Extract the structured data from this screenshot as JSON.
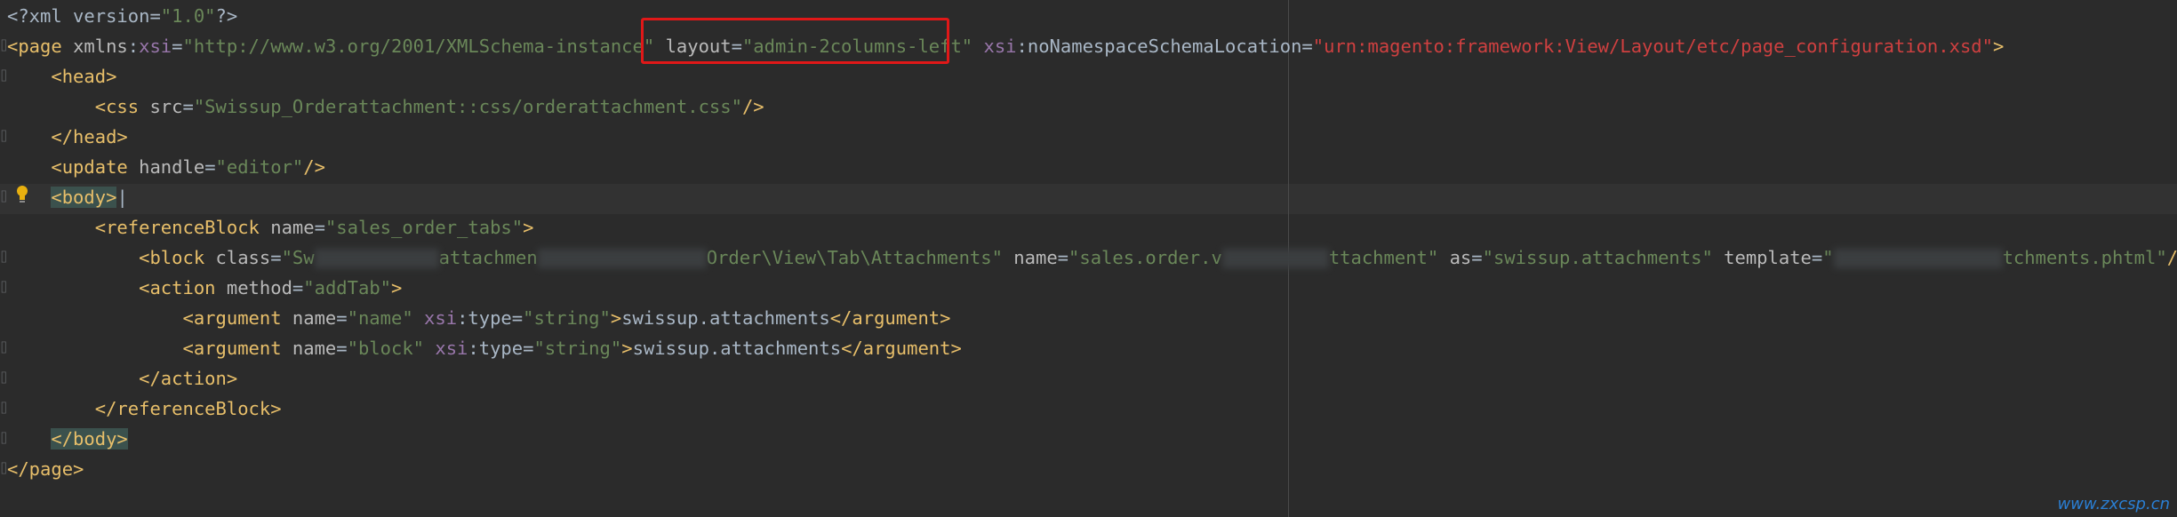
{
  "lines": [
    {
      "parts": [
        [
          "t-txt",
          "<?xml version="
        ],
        [
          "t-str",
          "\"1.0\""
        ],
        [
          "t-txt",
          "?>"
        ]
      ]
    },
    {
      "parts": [
        [
          "t-tag",
          "<page "
        ],
        [
          "t-attr",
          "xmlns"
        ],
        [
          "t-txt",
          ":"
        ],
        [
          "t-ns",
          "xsi"
        ],
        [
          "t-txt",
          "="
        ],
        [
          "t-str",
          "\"http://www.w3.org/2001/XMLSchema-instance\""
        ],
        [
          "t-txt",
          " "
        ],
        [
          "t-attr",
          "layout"
        ],
        [
          "t-txt",
          "="
        ],
        [
          "t-str",
          "\"admin-2columns-left\""
        ],
        [
          "t-txt",
          " "
        ],
        [
          "t-ns",
          "xsi"
        ],
        [
          "t-txt",
          ":noNamespaceSchemaLocation="
        ],
        [
          "t-url",
          "\"urn:magento:framework:View/Layout/etc/page_configuration.xsd\""
        ],
        [
          "t-tag",
          ">"
        ]
      ]
    },
    {
      "parts": [
        [
          "t-txt",
          "    "
        ],
        [
          "t-tag",
          "<head>"
        ]
      ]
    },
    {
      "parts": [
        [
          "t-txt",
          "        "
        ],
        [
          "t-tag",
          "<css "
        ],
        [
          "t-attr",
          "src"
        ],
        [
          "t-txt",
          "="
        ],
        [
          "t-str",
          "\"Swissup_Orderattachment::css/orderattachment.css\""
        ],
        [
          "t-tag",
          "/>"
        ]
      ]
    },
    {
      "parts": [
        [
          "t-txt",
          "    "
        ],
        [
          "t-tag",
          "</head>"
        ]
      ]
    },
    {
      "parts": [
        [
          "t-txt",
          "    "
        ],
        [
          "t-tag",
          "<update "
        ],
        [
          "t-attr",
          "handle"
        ],
        [
          "t-txt",
          "="
        ],
        [
          "t-str",
          "\"editor\""
        ],
        [
          "t-tag",
          "/>"
        ]
      ]
    },
    {
      "parts": [
        [
          "t-txt",
          "    "
        ],
        [
          "hl",
          "<body>"
        ],
        [
          "t-txt",
          "|"
        ]
      ]
    },
    {
      "parts": [
        [
          "t-txt",
          "        "
        ],
        [
          "t-tag",
          "<referenceBlock "
        ],
        [
          "t-attr",
          "name"
        ],
        [
          "t-txt",
          "="
        ],
        [
          "t-str",
          "\"sales_order_tabs\""
        ],
        [
          "t-tag",
          ">"
        ]
      ]
    },
    {
      "parts": [
        [
          "t-txt",
          "            "
        ],
        [
          "t-tag",
          "<block "
        ],
        [
          "t-attr",
          "class"
        ],
        [
          "t-txt",
          "="
        ],
        [
          "t-str",
          "\"Sw"
        ],
        [
          "blur",
          "140"
        ],
        [
          "t-str",
          "attachmen"
        ],
        [
          "blur",
          "190"
        ],
        [
          "t-str",
          "Order\\View\\Tab\\Attachments\""
        ],
        [
          "t-txt",
          " "
        ],
        [
          "t-attr",
          "name"
        ],
        [
          "t-txt",
          "="
        ],
        [
          "t-str",
          "\"sales.order.v"
        ],
        [
          "blur",
          "120"
        ],
        [
          "t-str",
          "ttachment\""
        ],
        [
          "t-txt",
          " "
        ],
        [
          "t-attr",
          "as"
        ],
        [
          "t-txt",
          "="
        ],
        [
          "t-str",
          "\"swissup.attachments\""
        ],
        [
          "t-txt",
          " "
        ],
        [
          "t-attr",
          "template"
        ],
        [
          "t-txt",
          "="
        ],
        [
          "t-str",
          "\""
        ],
        [
          "blur",
          "190"
        ],
        [
          "t-str",
          "tchments.phtml\""
        ],
        [
          "t-tag",
          "/>"
        ]
      ]
    },
    {
      "parts": [
        [
          "t-txt",
          "            "
        ],
        [
          "t-tag",
          "<action "
        ],
        [
          "t-attr",
          "method"
        ],
        [
          "t-txt",
          "="
        ],
        [
          "t-str",
          "\"addTab\""
        ],
        [
          "t-tag",
          ">"
        ]
      ]
    },
    {
      "parts": [
        [
          "t-txt",
          "                "
        ],
        [
          "t-tag",
          "<argument "
        ],
        [
          "t-attr",
          "name"
        ],
        [
          "t-txt",
          "="
        ],
        [
          "t-str",
          "\"name\""
        ],
        [
          "t-txt",
          " "
        ],
        [
          "t-ns",
          "xsi"
        ],
        [
          "t-txt",
          ":type="
        ],
        [
          "t-str",
          "\"string\""
        ],
        [
          "t-tag",
          ">"
        ],
        [
          "t-txt",
          "swissup.attachments"
        ],
        [
          "t-tag",
          "</argument>"
        ]
      ]
    },
    {
      "parts": [
        [
          "t-txt",
          "                "
        ],
        [
          "t-tag",
          "<argument "
        ],
        [
          "t-attr",
          "name"
        ],
        [
          "t-txt",
          "="
        ],
        [
          "t-str",
          "\"block\""
        ],
        [
          "t-txt",
          " "
        ],
        [
          "t-ns",
          "xsi"
        ],
        [
          "t-txt",
          ":type="
        ],
        [
          "t-str",
          "\"string\""
        ],
        [
          "t-tag",
          ">"
        ],
        [
          "t-txt",
          "swissup.attachments"
        ],
        [
          "t-tag",
          "</argument>"
        ]
      ]
    },
    {
      "parts": [
        [
          "t-txt",
          "            "
        ],
        [
          "t-tag",
          "</action>"
        ]
      ]
    },
    {
      "parts": [
        [
          "t-txt",
          "        "
        ],
        [
          "t-tag",
          "</referenceBlock>"
        ]
      ]
    },
    {
      "parts": [
        [
          "t-txt",
          "    "
        ],
        [
          "hl",
          "</body>"
        ]
      ]
    },
    {
      "parts": [
        [
          "t-tag",
          "</page>"
        ]
      ]
    }
  ],
  "watermark": "www.zxcsp.cn",
  "colors": {
    "background": "#2b2b2b",
    "tag": "#e8bf6a",
    "string": "#6a8759",
    "namespace": "#9876aa",
    "highlight_box": "#e01818"
  }
}
